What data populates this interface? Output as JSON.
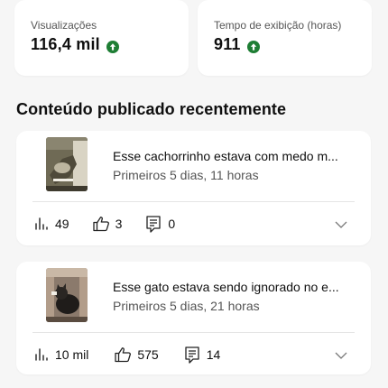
{
  "stats": [
    {
      "label": "Visualizações",
      "value": "116,4 mil",
      "trend_icon": "arrow-up-circle-icon"
    },
    {
      "label": "Tempo de exibição (horas)",
      "value": "911",
      "trend_icon": "arrow-up-circle-icon"
    }
  ],
  "colors": {
    "trend_up": "#1e7e34",
    "background": "#f6f6f6",
    "card": "#ffffff"
  },
  "section": {
    "title": "Conteúdo publicado recentemente"
  },
  "videos": [
    {
      "title": "Esse cachorrinho estava com medo m...",
      "subtitle": "Primeiros 5 dias, 11 horas",
      "views": "49",
      "likes": "3",
      "comments": "0"
    },
    {
      "title": "Esse gato estava sendo ignorado no e...",
      "subtitle": "Primeiros 5 dias, 21 horas",
      "views": "10 mil",
      "likes": "575",
      "comments": "14"
    }
  ]
}
